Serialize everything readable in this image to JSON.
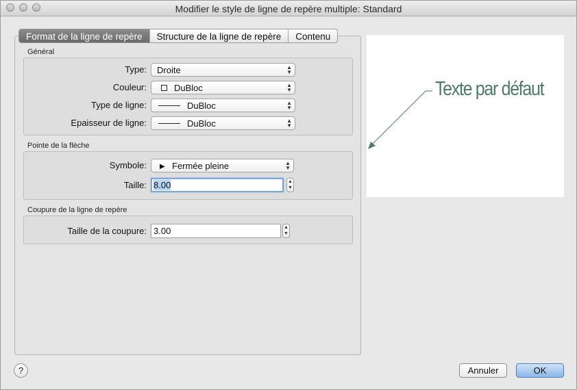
{
  "window": {
    "title": "Modifier le style de ligne de repère multiple: Standard"
  },
  "tabs": [
    {
      "label": "Format de la ligne de repère",
      "active": true
    },
    {
      "label": "Structure de la ligne de repère",
      "active": false
    },
    {
      "label": "Contenu",
      "active": false
    }
  ],
  "general": {
    "section_label": "Général",
    "type": {
      "label": "Type:",
      "value": "Droite"
    },
    "couleur": {
      "label": "Couleur:",
      "value": "DuBloc"
    },
    "type_ligne": {
      "label": "Type de ligne:",
      "value": "DuBloc"
    },
    "epaisseur": {
      "label": "Epaisseur de ligne:",
      "value": "DuBloc"
    }
  },
  "arrow": {
    "section_label": "Pointe de la flèche",
    "symbole": {
      "label": "Symbole:",
      "value": "Fermée pleine"
    },
    "taille": {
      "label": "Taille:",
      "value": "8.00"
    }
  },
  "break": {
    "section_label": "Coupure de la ligne de repère",
    "taille_coupure": {
      "label": "Taille de la coupure:",
      "value": "3.00"
    }
  },
  "preview": {
    "text": "Texte par défaut",
    "text_color": "#4e7a6c"
  },
  "footer": {
    "help": "?",
    "cancel": "Annuler",
    "ok": "OK"
  },
  "colors": {
    "accent": "#7fa7d9",
    "ok_button": "#8ab6e8"
  }
}
